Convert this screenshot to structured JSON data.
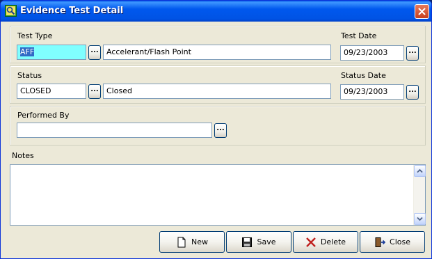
{
  "window": {
    "title": "Evidence Test Detail",
    "app_icon": "magnifier-icon",
    "close_icon": "close-icon"
  },
  "test": {
    "type_label": "Test Type",
    "type_code": "AFF",
    "type_desc": "Accelerant/Flash Point",
    "date_label": "Test Date",
    "date_value": "09/23/2003"
  },
  "status": {
    "label": "Status",
    "code": "CLOSED",
    "desc": "Closed",
    "date_label": "Status Date",
    "date_value": "09/23/2003"
  },
  "performed": {
    "label": "Performed By",
    "value": ""
  },
  "notes": {
    "label": "Notes",
    "value": ""
  },
  "ellipsis_label": "...",
  "buttons": {
    "new": "New",
    "save": "Save",
    "delete": "Delete",
    "close": "Close"
  },
  "colors": {
    "title_bar": "#0058ee",
    "highlight_field": "#80ffff",
    "selection": "#316ac5"
  }
}
